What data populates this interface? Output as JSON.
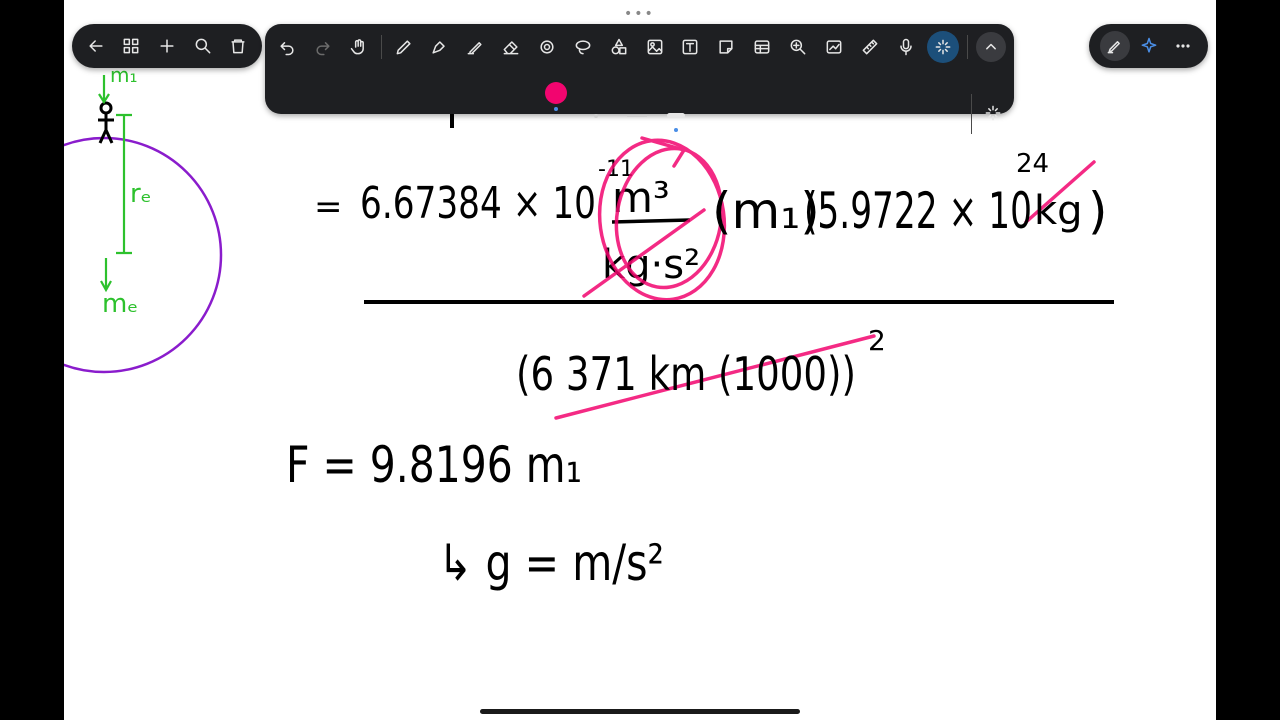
{
  "app": {
    "handle_dots": "•••"
  },
  "left_toolbar": {
    "items": [
      "back-arrow-icon",
      "grid-icon",
      "plus-icon",
      "search-icon",
      "trash-icon"
    ]
  },
  "main_toolbar": {
    "active_pen_color": "#f2056f",
    "thickness_options": [
      "dot",
      "line-thin",
      "line-thick"
    ]
  },
  "right_toolbar": {
    "items": [
      "pen-edit-icon",
      "sparkle-icon",
      "more-icon"
    ]
  },
  "diagram": {
    "label_m1": "m₁",
    "label_re": "rₑ",
    "label_me": "mₑ",
    "circle_color": "#8a1ccc",
    "ink_color": "#2dc12d"
  },
  "equation": {
    "line1_eq": "=",
    "G": "6.67384 × 10",
    "G_exp": "-11",
    "unit_num": "m³",
    "unit_den": "kg·s²",
    "m1": "(m₁)",
    "Me": "(5.9722 × 10",
    "Me_exp": "24",
    "Me_unit": "kg",
    "Me_close": ")",
    "denominator": "(6 371 km (1000))",
    "den_exp": "2",
    "line2": "F = 9.8196  m₁",
    "line3": "↳  g = m/s²"
  }
}
